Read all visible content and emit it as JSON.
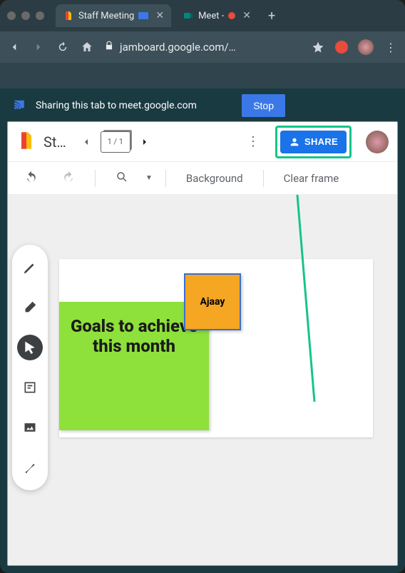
{
  "browser": {
    "tabs": [
      {
        "title": "Staff Meeting",
        "favicon": "jamboard"
      },
      {
        "title": "Meet -",
        "favicon": "meet"
      }
    ],
    "url": "jamboard.google.com/…",
    "sharing_text": "Sharing this tab to meet.google.com",
    "stop_label": "Stop"
  },
  "app": {
    "doc_title": "St…",
    "frame_counter": "1 / 1",
    "share_label": "SHARE",
    "toolbar": {
      "background_label": "Background",
      "clear_label": "Clear frame"
    }
  },
  "notes": {
    "green": "Goals to achieve this month",
    "orange": "Ajaay"
  }
}
